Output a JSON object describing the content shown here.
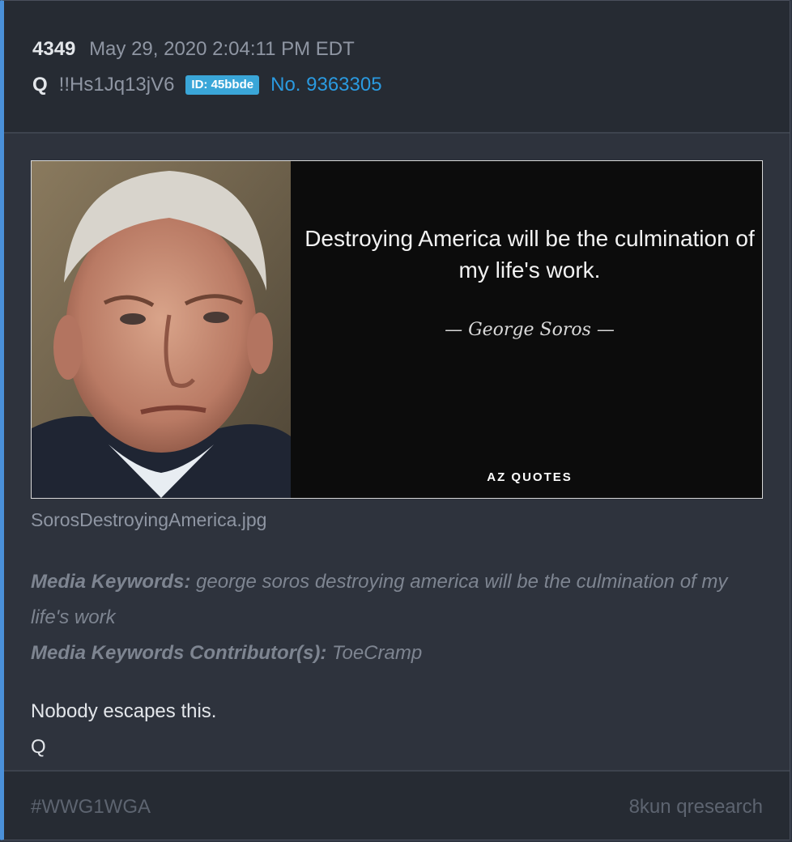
{
  "post": {
    "number": "4349",
    "datetime": "May 29, 2020 2:04:11 PM EDT",
    "author": "Q",
    "tripcode": "!!Hs1Jq13jV6",
    "id_badge": "ID: 45bbde",
    "post_no": "No. 9363305"
  },
  "media": {
    "quote": "Destroying America will be the culmination of my life's work.",
    "attribution": "— George Soros —",
    "brand": "AZ QUOTES",
    "filename": "SorosDestroyingAmerica.jpg"
  },
  "keywords": {
    "label": "Media Keywords:",
    "value": "george soros destroying america will be the culmination of my life's work",
    "contributor_label": "Media Keywords Contributor(s):",
    "contributor": "ToeCramp"
  },
  "message": {
    "line1": "Nobody escapes this.",
    "line2": "Q"
  },
  "footer": {
    "hashtag": "#WWG1WGA",
    "board": "8kun qresearch"
  },
  "colors": {
    "accent": "#4a90d9",
    "id_badge": "#3aa6d8",
    "link": "#2a9ae0"
  }
}
